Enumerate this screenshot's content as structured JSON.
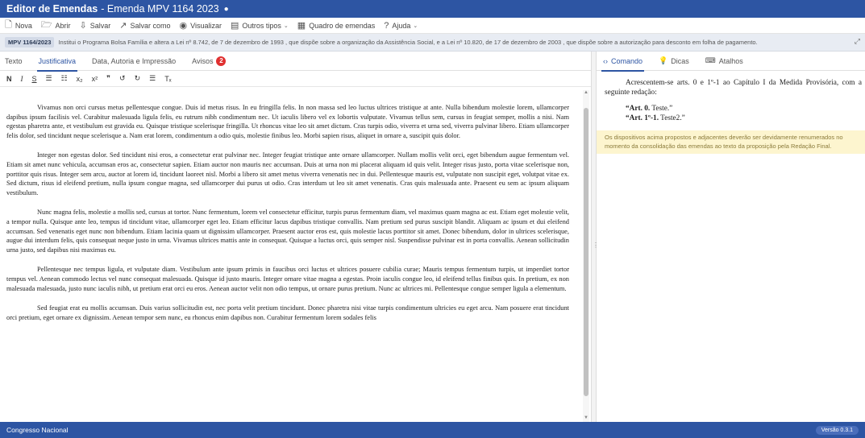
{
  "window": {
    "title_bold": "Editor de Emendas",
    "title_rest": "- Emenda MPV 1164 2023",
    "dot": "●"
  },
  "toolbar": {
    "items": [
      {
        "icon": "new-file-icon",
        "glyph": "🗋",
        "label": "Nova"
      },
      {
        "icon": "folder-open-icon",
        "glyph": "🗁",
        "label": "Abrir"
      },
      {
        "icon": "save-icon",
        "glyph": "⇩",
        "label": "Salvar"
      },
      {
        "icon": "save-as-icon",
        "glyph": "↗",
        "label": "Salvar como"
      },
      {
        "icon": "eye-icon",
        "glyph": "◉",
        "label": "Visualizar"
      },
      {
        "icon": "list-icon",
        "glyph": "▤",
        "label": "Outros tipos",
        "caret": "⌄"
      },
      {
        "icon": "table-icon",
        "glyph": "▦",
        "label": "Quadro de emendas"
      },
      {
        "icon": "help-icon",
        "glyph": "?",
        "label": "Ajuda",
        "caret": "⌄"
      }
    ]
  },
  "info": {
    "badge": "MPV 1164/2023",
    "text": "Institui o Programa Bolsa Família e altera a Lei nº 8.742, de 7 de dezembro de 1993 , que dispõe sobre a organização da Assistência Social, e a Lei nº 10.820, de 17 de dezembro de 2003 , que dispõe sobre a autorização para desconto em folha de pagamento."
  },
  "tabs": [
    {
      "label": "Texto",
      "active": false
    },
    {
      "label": "Justificativa",
      "active": true
    },
    {
      "label": "Data, Autoria e Impressão",
      "active": false
    },
    {
      "label": "Avisos",
      "active": false,
      "count": "2"
    }
  ],
  "format_bar": [
    "N",
    "I",
    "S",
    "☰",
    "☷",
    "x₂",
    "x²",
    "❞",
    "↺",
    "↻",
    "☰",
    "Tₓ"
  ],
  "editor": {
    "paragraphs": [
      "Vivamus non orci cursus metus pellentesque congue. Duis id metus risus. In eu fringilla felis. In non massa sed leo luctus ultrices tristique at ante. Nulla bibendum molestie lorem, ullamcorper dapibus ipsum facilisis vel. Curabitur malesuada ligula felis, eu rutrum nibh condimentum nec. Ut iaculis libero vel ex lobortis vulputate. Vivamus tellus sem, cursus in feugiat semper, mollis a nisi. Nam egestas pharetra ante, et vestibulum est gravida eu. Quisque tristique scelerisque fringilla. Ut rhoncus vitae leo sit amet dictum. Cras turpis odio, viverra et urna sed, viverra pulvinar libero. Etiam ullamcorper felis dolor, sed tincidunt neque scelerisque a. Nam erat lorem, condimentum a odio quis, molestie finibus leo. Morbi sapien risus, aliquet in ornare a, suscipit quis dolor.",
      "Integer non egestas dolor. Sed tincidunt nisi eros, a consectetur erat pulvinar nec. Integer feugiat tristique ante ornare ullamcorper. Nullam mollis velit orci, eget bibendum augue fermentum vel. Etiam sit amet nunc vehicula, accumsan eros ac, consectetur sapien. Etiam auctor non mauris nec accumsan. Duis at urna non mi placerat aliquam id quis velit. Integer risus justo, porta vitae scelerisque non, porttitor quis risus. Integer sem arcu, auctor at lorem id, tincidunt laoreet nisl. Morbi a libero sit amet metus viverra venenatis nec in dui. Pellentesque mauris est, vulputate non suscipit eget, volutpat vitae ex. Sed dictum, risus id eleifend pretium, nulla ipsum congue magna, sed ullamcorper dui purus ut odio. Cras interdum ut leo sit amet venenatis. Cras quis malesuada ante. Praesent eu sem ac ipsum aliquam vestibulum.",
      "Nunc magna felis, molestie a mollis sed, cursus at tortor. Nunc fermentum, lorem vel consectetur efficitur, turpis purus fermentum diam, vel maximus quam magna ac est. Etiam eget molestie velit, a tempor nulla. Quisque ante leo, tempus id tincidunt vitae, ullamcorper eget leo. Etiam efficitur lacus dapibus tristique convallis. Nam pretium sed purus suscipit blandit. Aliquam ac ipsum et dui eleifend accumsan. Sed venenatis eget nunc non bibendum. Etiam lacinia quam ut dignissim ullamcorper. Praesent auctor eros est, quis molestie lacus porttitor sit amet. Donec bibendum, dolor in ultrices scelerisque, augue dui interdum felis, quis consequat neque justo in urna. Vivamus ultrices mattis ante in consequat. Quisque a luctus orci, quis semper nisl. Suspendisse pulvinar est in porta convallis. Aenean sollicitudin urna justo, sed dapibus nisi maximus eu.",
      "Pellentesque nec tempus ligula, et vulputate diam. Vestibulum ante ipsum primis in faucibus orci luctus et ultrices posuere cubilia curae; Mauris tempus fermentum turpis, ut imperdiet tortor tempus vel. Aenean commodo lectus vel nunc consequat malesuada. Quisque id justo mauris. Integer ornare vitae magna a egestas. Proin iaculis congue leo, id eleifend tellus finibus quis. In pretium, ex non malesuada malesuada, justo nunc iaculis nibh, ut pretium erat orci eu eros. Aenean auctor velit non odio tempus, ut ornare purus pretium. Nunc ac ultrices mi. Pellentesque congue semper ligula a elementum.",
      "Sed feugiat erat eu mollis accumsan. Duis varius sollicitudin est, nec porta velit pretium tincidunt. Donec pharetra nisi vitae turpis condimentum ultricies eu eget arcu. Nam posuere erat tincidunt orci pretium, eget ornare ex dignissim. Aenean tempor sem nunc, eu rhoncus enim dapibus non. Curabitur fermentum lorem sodales felis"
    ]
  },
  "right_tabs": [
    {
      "icon": "code-icon",
      "glyph": "‹›",
      "label": "Comando",
      "active": true
    },
    {
      "icon": "lightbulb-icon",
      "glyph": "💡",
      "label": "Dicas",
      "active": false
    },
    {
      "icon": "keyboard-icon",
      "glyph": "⌨",
      "label": "Atalhos",
      "active": false
    }
  ],
  "command": {
    "intro": "Acrescentem-se arts. 0 e 1º-1 ao Capítulo I da Medida Provisória, com a seguinte redação:",
    "art0_bold": "“Art. 0.",
    "art0_rest": " Teste.”",
    "art1_bold": "“Art. 1º-1.",
    "art1_rest": " Teste2.”",
    "note": "Os dispositivos acima propostos e adjacentes deverão ser devidamente renumerados no momento da consolidação das emendas ao texto da proposição pela Redação Final."
  },
  "status": {
    "left": "Congresso Nacional",
    "version": "Versão 0.3.1"
  },
  "colors": {
    "brand": "#2d55a3",
    "alert": "#e03030",
    "note_bg": "#fdf5cf"
  }
}
